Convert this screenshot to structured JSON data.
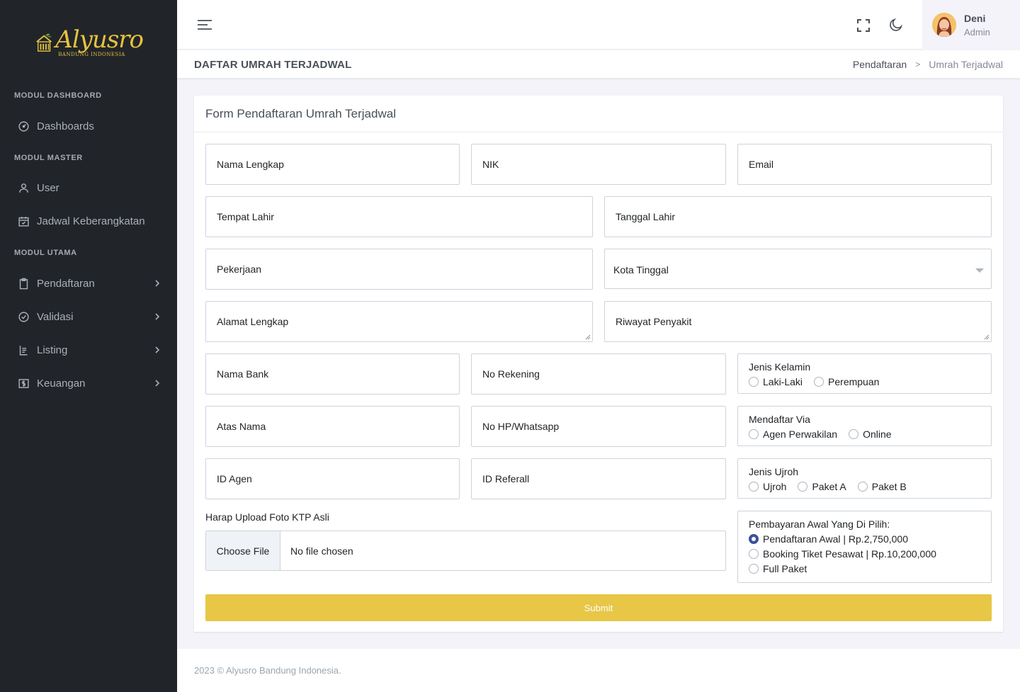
{
  "brand": {
    "name": "Alyusro",
    "tagline": "BANDUNG INDONESIA"
  },
  "sidebar": {
    "sections": [
      {
        "title": "MODUL DASHBOARD"
      },
      {
        "title": "MODUL MASTER"
      },
      {
        "title": "MODUL UTAMA"
      }
    ],
    "items": [
      {
        "label": "Dashboards",
        "icon": "dashboard-icon"
      },
      {
        "label": "User",
        "icon": "user-icon"
      },
      {
        "label": "Jadwal Keberangkatan",
        "icon": "calendar-icon"
      },
      {
        "label": "Pendaftaran",
        "icon": "clipboard-icon"
      },
      {
        "label": "Validasi",
        "icon": "check-circle-icon"
      },
      {
        "label": "Listing",
        "icon": "list-icon"
      },
      {
        "label": "Keuangan",
        "icon": "money-icon"
      }
    ]
  },
  "header": {
    "user_name": "Deni",
    "user_role": "Admin"
  },
  "page": {
    "title": "DAFTAR UMRAH TERJADWAL",
    "breadcrumb": [
      "Pendaftaran",
      "Umrah Terjadwal"
    ],
    "separator": ">"
  },
  "form": {
    "title": "Form Pendaftaran Umrah Terjadwal",
    "fields": {
      "nama_lengkap": "Nama Lengkap",
      "nik": "NIK",
      "email": "Email",
      "tempat_lahir": "Tempat Lahir",
      "tanggal_lahir": "Tanggal Lahir",
      "pekerjaan": "Pekerjaan",
      "kota_tinggal": "Kota Tinggal",
      "alamat_lengkap": "Alamat Lengkap",
      "riwayat_penyakit": "Riwayat Penyakit",
      "nama_bank": "Nama Bank",
      "no_rekening": "No Rekening",
      "atas_nama": "Atas Nama",
      "no_hp": "No HP/Whatsapp",
      "id_agen": "ID Agen",
      "id_referall": "ID Referall"
    },
    "jenis_kelamin": {
      "label": "Jenis Kelamin",
      "options": [
        "Laki-Laki",
        "Perempuan"
      ]
    },
    "mendaftar_via": {
      "label": "Mendaftar Via",
      "options": [
        "Agen Perwakilan",
        "Online"
      ]
    },
    "jenis_ujroh": {
      "label": "Jenis Ujroh",
      "options": [
        "Ujroh",
        "Paket A",
        "Paket B"
      ]
    },
    "pembayaran": {
      "label": "Pembayaran Awal Yang Di Pilih:",
      "options": [
        "Pendaftaran Awal | Rp.2,750,000",
        "Booking Tiket Pesawat | Rp.10,200,000",
        "Full Paket"
      ],
      "selected": "Pendaftaran Awal | Rp.2,750,000"
    },
    "upload": {
      "label": "Harap Upload Foto KTP Asli",
      "button": "Choose File",
      "status": "No file chosen"
    },
    "submit_label": "Submit"
  },
  "footer": {
    "text": "2023 © Alyusro Bandung Indonesia."
  },
  "colors": {
    "sidebar": "#212529",
    "accent_gold": "#e8c646",
    "radio_checked": "#3b4f9c"
  }
}
